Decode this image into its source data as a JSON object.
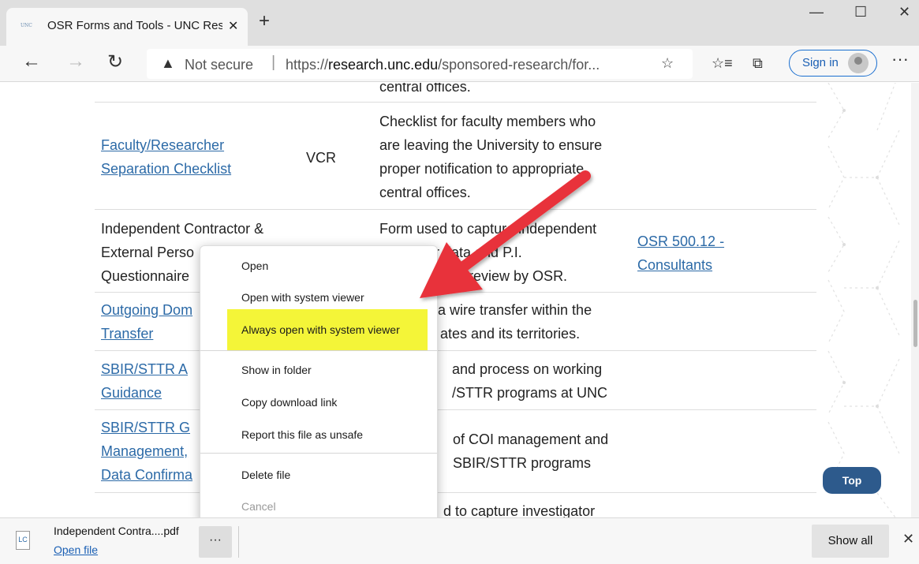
{
  "browser": {
    "tab_title": "OSR Forms and Tools - UNC Rese",
    "tab_favicon_text": "UNC",
    "tab_close": "✕",
    "new_tab": "+",
    "minimize": "—",
    "maximize": "☐",
    "close": "✕",
    "back": "←",
    "forward": "→",
    "refresh": "↻",
    "security_icon": "▲",
    "security_label": "Not secure",
    "separator": "|",
    "url_prefix": "https://",
    "url_host": "research.unc.edu",
    "url_path": "/sponsored-research/for...",
    "favorite_icon": "☆",
    "favorites_icon": "☆≡",
    "collections_icon": "⧉",
    "sign_in": "Sign in",
    "more": "···"
  },
  "table": {
    "row0_desc": "central offices.",
    "row1_name_line1": "Faculty/Researcher",
    "row1_name_line2": "Separation Checklist",
    "row1_office": "VCR",
    "row1_desc_l1": "Checklist for faculty members who",
    "row1_desc_l2": "are leaving the University to ensure",
    "row1_desc_l3": "proper notification to appropriate",
    "row1_desc_l4": "central offices.",
    "row2_name_l1": "Independent Contractor &",
    "row2_name_l2": "External Perso",
    "row2_name_l3": "Questionnaire",
    "row2_desc_l1": "Form used to capture independent",
    "row2_desc_l2": "or data and P.I.",
    "row2_desc_l3": "on for review by OSR.",
    "row2_policy_l1": "OSR 500.12 -",
    "row2_policy_l2": "Consultants",
    "row3_name_l1": "Outgoing Dom",
    "row3_name_l2": "Transfer",
    "row3_desc_l1": "a wire transfer within the",
    "row3_desc_l2": "ates and its territories.",
    "row4_name_l1": "SBIR/STTR A",
    "row4_name_l2": "Guidance",
    "row4_desc_l1": "and process on working",
    "row4_desc_l2": "/STTR programs at UNC",
    "row5_name_l1": "SBIR/STTR G",
    "row5_name_l2": "Management,",
    "row5_name_l3": "Data Confirma",
    "row5_desc_l1": "of COI management and",
    "row5_desc_l2": "SBIR/STTR programs",
    "row6_desc_l1": "d to capture investigator"
  },
  "top_button": "Top",
  "context_menu": {
    "open": "Open",
    "open_system": "Open with system viewer",
    "always_open_system": "Always open with system viewer",
    "show_folder": "Show in folder",
    "copy_link": "Copy download link",
    "report_unsafe": "Report this file as unsafe",
    "delete_file": "Delete file",
    "cancel": "Cancel",
    "highlight_color": "#f4f538"
  },
  "download_bar": {
    "file_icon_text": "LC",
    "file_name": "Independent Contra....pdf",
    "open_file": "Open file",
    "more": "···",
    "show_all": "Show all",
    "close": "✕"
  },
  "annotation": {
    "arrow_color": "#e8333a"
  }
}
